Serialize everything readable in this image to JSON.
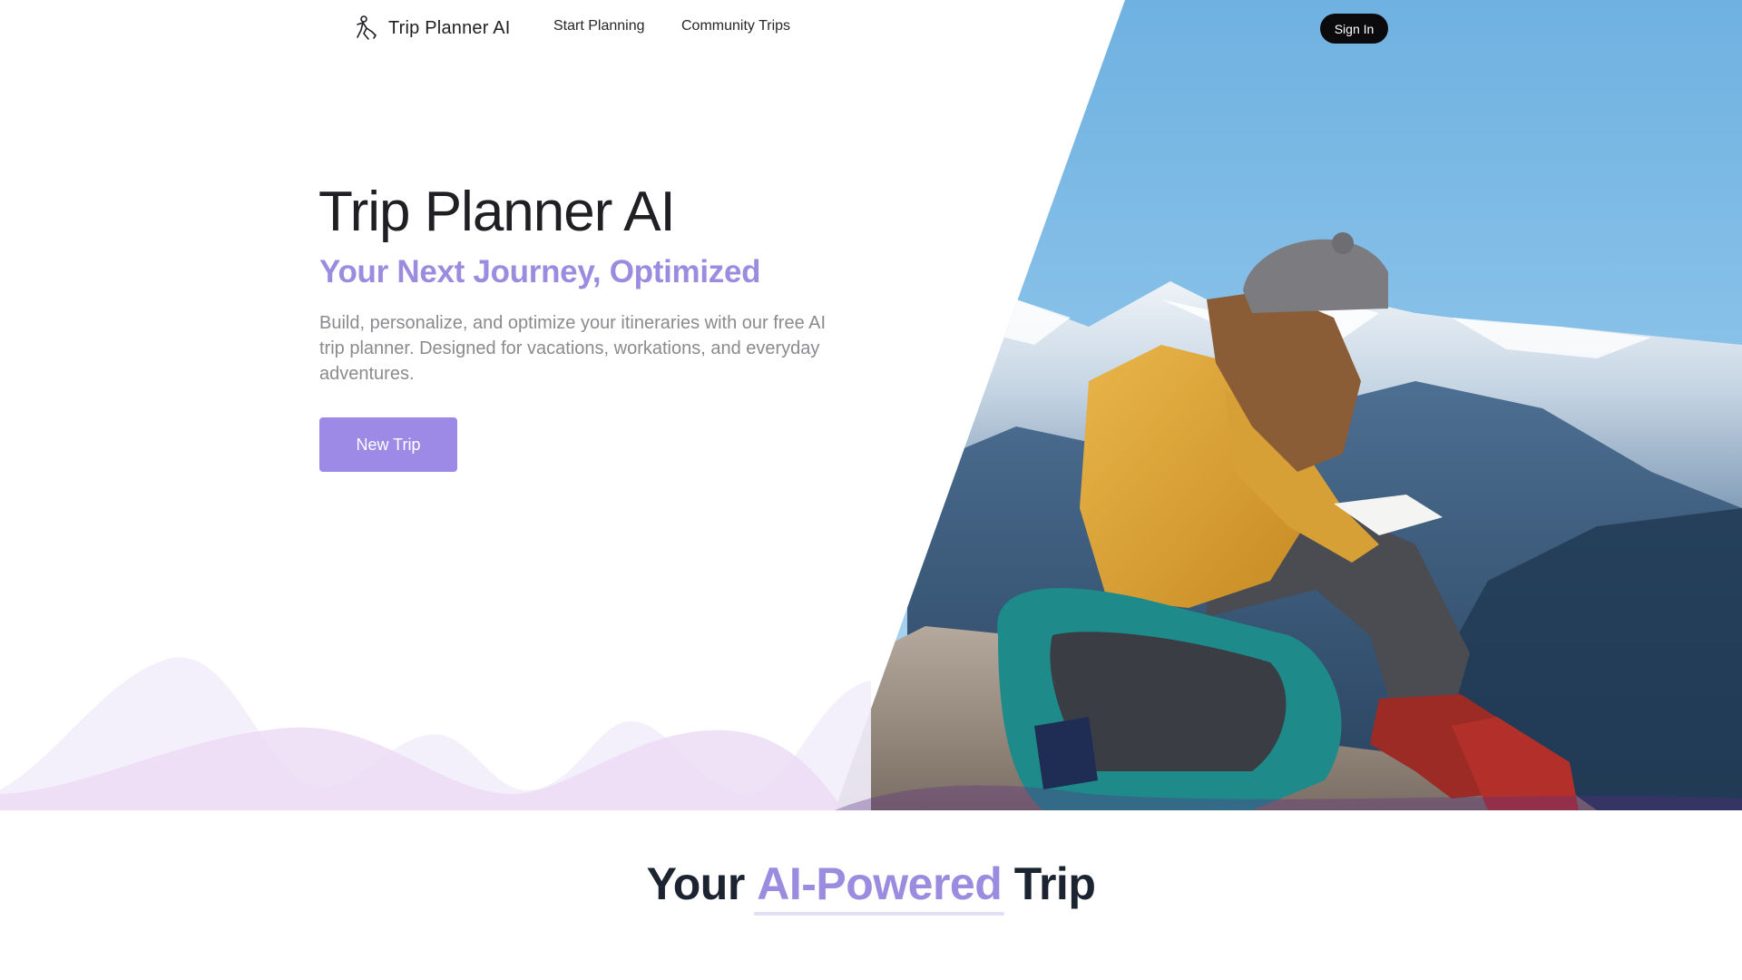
{
  "nav": {
    "brand": "Trip Planner AI",
    "brand_icon": "walking-person-icon",
    "links": [
      "Start Planning",
      "Community Trips"
    ],
    "sign_in": "Sign In"
  },
  "hero": {
    "title": "Trip Planner AI",
    "subtitle": "Your Next Journey, Optimized",
    "description": "Build, personalize, and optimize your itineraries with our free AI trip planner. Designed for vacations, workations, and everyday adventures.",
    "cta": "New Trip",
    "image": "traveler-writing-on-mountain-photo"
  },
  "section": {
    "heading_pre": "Your",
    "heading_accent": "AI-Powered",
    "heading_post": "Trip"
  },
  "colors": {
    "accent": "#9c8ae6",
    "dark": "#0b0b0d",
    "text_muted": "#8a8a8f"
  }
}
